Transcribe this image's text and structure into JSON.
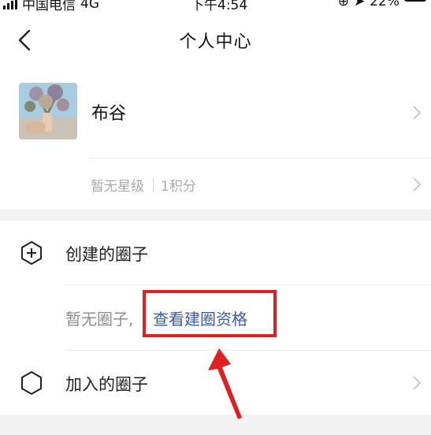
{
  "status": {
    "carrier": "中国电信",
    "network": "4G",
    "time": "下午4:54",
    "battery": "22%"
  },
  "nav": {
    "title": "个人中心"
  },
  "profile": {
    "name": "布谷",
    "star_level": "暂无星级",
    "points": "1积分"
  },
  "circles": {
    "created_label": "创建的圈子",
    "empty_text": "暂无圈子,",
    "view_qualification_link": "查看建圈资格",
    "joined_label": "加入的圈子"
  },
  "colors": {
    "link": "#3d5aa8",
    "highlight_border": "#e02020",
    "annotation_arrow": "#e02020",
    "section_gap": "#f2f2f3"
  }
}
